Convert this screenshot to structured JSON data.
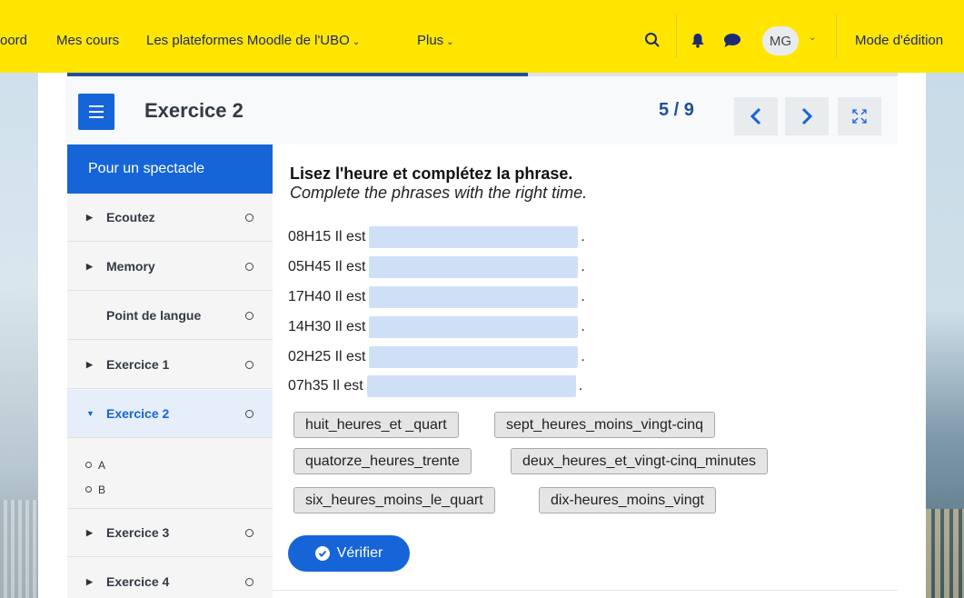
{
  "nav": {
    "items": [
      {
        "label": "oord",
        "chevron": false
      },
      {
        "label": "Mes cours",
        "chevron": false
      },
      {
        "label": "Les plateformes Moodle de l'UBO",
        "chevron": true
      },
      {
        "label": "Plus",
        "chevron": true
      }
    ],
    "avatar_initials": "MG",
    "edit_mode_label": "Mode d'édition",
    "icons": [
      "search-icon",
      "bell-icon",
      "chat-icon",
      "chevron-down-icon"
    ]
  },
  "header": {
    "title": "Exercice 2",
    "page_count": "5 / 9",
    "progress_fraction": 0.555,
    "prev_icon": "‹",
    "next_icon": "›",
    "fullscreen_icon": "expand-icon"
  },
  "sidebar": {
    "heading": "Pour un spectacle",
    "items": [
      {
        "label": "Ecoutez",
        "expandable": true
      },
      {
        "label": "Memory",
        "expandable": true
      },
      {
        "label": "Point de langue",
        "expandable": false
      },
      {
        "label": "Exercice 1",
        "expandable": true
      },
      {
        "label": "Exercice 2",
        "expandable": true,
        "active": true
      },
      {
        "label": "Exercice 3",
        "expandable": true
      },
      {
        "label": "Exercice 4",
        "expandable": true
      }
    ],
    "sub_items": [
      "A",
      "B"
    ]
  },
  "exercise": {
    "instruction": "Lisez l'heure et complétez la phrase.",
    "instruction_en": "Complete the phrases with the right time.",
    "rows": [
      {
        "prefix": "08H15 Il est",
        "suffix": "."
      },
      {
        "prefix": "05H45 Il est",
        "suffix": "."
      },
      {
        "prefix": "17H40 Il est",
        "suffix": "."
      },
      {
        "prefix": "14H30 Il est",
        "suffix": "."
      },
      {
        "prefix": "02H25 Il est",
        "suffix": "."
      },
      {
        "prefix": "07h35 Il est",
        "suffix": "."
      }
    ],
    "choices": [
      "huit_heures_et _quart",
      "sept_heures_moins_vingt-cinq",
      "quatorze_heures_trente",
      "deux_heures_et_vingt-cinq_minutes",
      "six_heures_moins_le_quart",
      "dix-heures_moins_vingt"
    ],
    "verify_label": "Vérifier"
  },
  "colors": {
    "nav_bg": "#ffe500",
    "primary": "#1565d8",
    "blank": "#cfe0f6",
    "active_item_bg": "#e5eef9"
  }
}
